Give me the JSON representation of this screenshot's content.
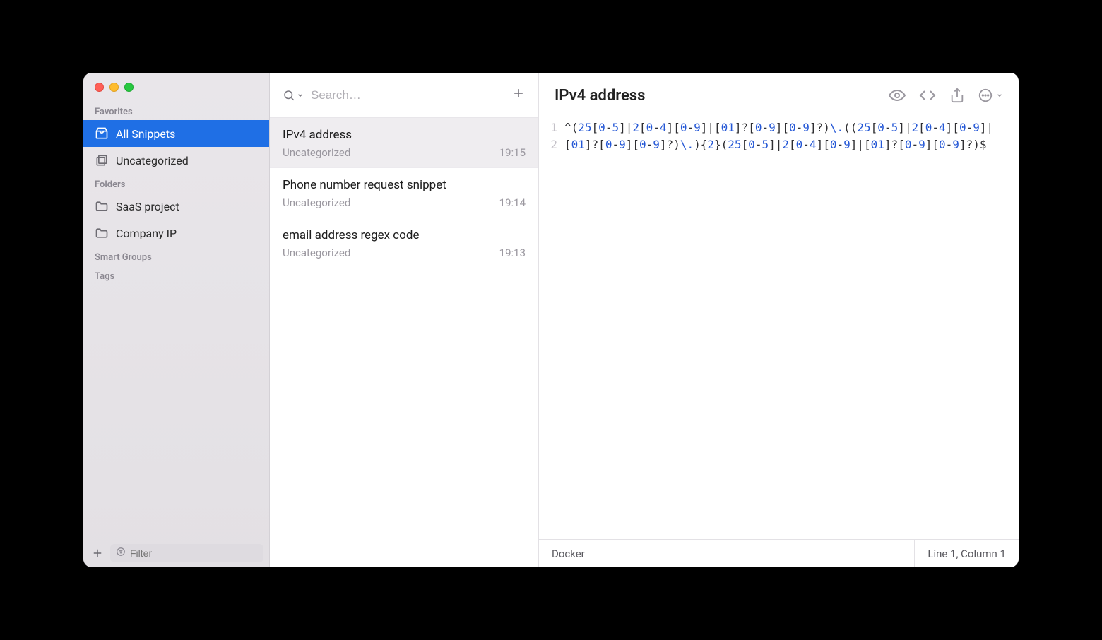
{
  "sidebar": {
    "sections": {
      "favorites_label": "Favorites",
      "folders_label": "Folders",
      "smart_groups_label": "Smart Groups",
      "tags_label": "Tags"
    },
    "favorites": [
      {
        "label": "All Snippets",
        "selected": true
      },
      {
        "label": "Uncategorized",
        "selected": false
      }
    ],
    "folders": [
      {
        "label": "SaaS project"
      },
      {
        "label": "Company IP"
      }
    ],
    "footer": {
      "filter_placeholder": "Filter"
    }
  },
  "list": {
    "search_placeholder": "Search…",
    "items": [
      {
        "title": "IPv4 address",
        "category": "Uncategorized",
        "time": "19:15",
        "selected": true
      },
      {
        "title": "Phone number request snippet",
        "category": "Uncategorized",
        "time": "19:14",
        "selected": false
      },
      {
        "title": "email address regex code",
        "category": "Uncategorized",
        "time": "19:13",
        "selected": false
      }
    ]
  },
  "detail": {
    "title": "IPv4 address",
    "line_numbers": [
      "1",
      "2"
    ],
    "code_tokens": [
      {
        "t": "p",
        "v": "^("
      },
      {
        "t": "n",
        "v": "25"
      },
      {
        "t": "p",
        "v": "["
      },
      {
        "t": "n",
        "v": "0"
      },
      {
        "t": "p",
        "v": "-"
      },
      {
        "t": "n",
        "v": "5"
      },
      {
        "t": "p",
        "v": "]|"
      },
      {
        "t": "n",
        "v": "2"
      },
      {
        "t": "p",
        "v": "["
      },
      {
        "t": "n",
        "v": "0"
      },
      {
        "t": "p",
        "v": "-"
      },
      {
        "t": "n",
        "v": "4"
      },
      {
        "t": "p",
        "v": "]["
      },
      {
        "t": "n",
        "v": "0"
      },
      {
        "t": "p",
        "v": "-"
      },
      {
        "t": "n",
        "v": "9"
      },
      {
        "t": "p",
        "v": "]|["
      },
      {
        "t": "n",
        "v": "01"
      },
      {
        "t": "p",
        "v": "]?["
      },
      {
        "t": "n",
        "v": "0"
      },
      {
        "t": "p",
        "v": "-"
      },
      {
        "t": "n",
        "v": "9"
      },
      {
        "t": "p",
        "v": "]["
      },
      {
        "t": "n",
        "v": "0"
      },
      {
        "t": "p",
        "v": "-"
      },
      {
        "t": "n",
        "v": "9"
      },
      {
        "t": "p",
        "v": "]?)"
      },
      {
        "t": "n",
        "v": "\\."
      },
      {
        "t": "p",
        "v": "(("
      },
      {
        "t": "n",
        "v": "25"
      },
      {
        "t": "p",
        "v": "["
      },
      {
        "t": "n",
        "v": "0"
      },
      {
        "t": "p",
        "v": "-"
      },
      {
        "t": "n",
        "v": "5"
      },
      {
        "t": "p",
        "v": "]|"
      },
      {
        "t": "n",
        "v": "2"
      },
      {
        "t": "p",
        "v": "["
      },
      {
        "t": "n",
        "v": "0"
      },
      {
        "t": "p",
        "v": "-"
      },
      {
        "t": "n",
        "v": "4"
      },
      {
        "t": "p",
        "v": "]["
      },
      {
        "t": "n",
        "v": "0"
      },
      {
        "t": "p",
        "v": "-"
      },
      {
        "t": "n",
        "v": "9"
      },
      {
        "t": "p",
        "v": "]|["
      },
      {
        "t": "n",
        "v": "01"
      },
      {
        "t": "p",
        "v": "]?["
      },
      {
        "t": "n",
        "v": "0"
      },
      {
        "t": "p",
        "v": "-"
      },
      {
        "t": "n",
        "v": "9"
      },
      {
        "t": "p",
        "v": "]["
      },
      {
        "t": "n",
        "v": "0"
      },
      {
        "t": "p",
        "v": "-"
      },
      {
        "t": "n",
        "v": "9"
      },
      {
        "t": "p",
        "v": "]?)"
      },
      {
        "t": "n",
        "v": "\\."
      },
      {
        "t": "p",
        "v": "){"
      },
      {
        "t": "n",
        "v": "2"
      },
      {
        "t": "p",
        "v": "}("
      },
      {
        "t": "n",
        "v": "25"
      },
      {
        "t": "p",
        "v": "["
      },
      {
        "t": "n",
        "v": "0"
      },
      {
        "t": "p",
        "v": "-"
      },
      {
        "t": "n",
        "v": "5"
      },
      {
        "t": "p",
        "v": "]|"
      },
      {
        "t": "n",
        "v": "2"
      },
      {
        "t": "p",
        "v": "["
      },
      {
        "t": "n",
        "v": "0"
      },
      {
        "t": "p",
        "v": "-"
      },
      {
        "t": "n",
        "v": "4"
      },
      {
        "t": "p",
        "v": "]["
      },
      {
        "t": "n",
        "v": "0"
      },
      {
        "t": "p",
        "v": "-"
      },
      {
        "t": "n",
        "v": "9"
      },
      {
        "t": "p",
        "v": "]|["
      },
      {
        "t": "n",
        "v": "01"
      },
      {
        "t": "p",
        "v": "]?["
      },
      {
        "t": "n",
        "v": "0"
      },
      {
        "t": "p",
        "v": "-"
      },
      {
        "t": "n",
        "v": "9"
      },
      {
        "t": "p",
        "v": "]["
      },
      {
        "t": "n",
        "v": "0"
      },
      {
        "t": "p",
        "v": "-"
      },
      {
        "t": "n",
        "v": "9"
      },
      {
        "t": "p",
        "v": "]?)$"
      }
    ],
    "status": {
      "syntax": "Docker",
      "position": "Line 1, Column 1"
    }
  }
}
